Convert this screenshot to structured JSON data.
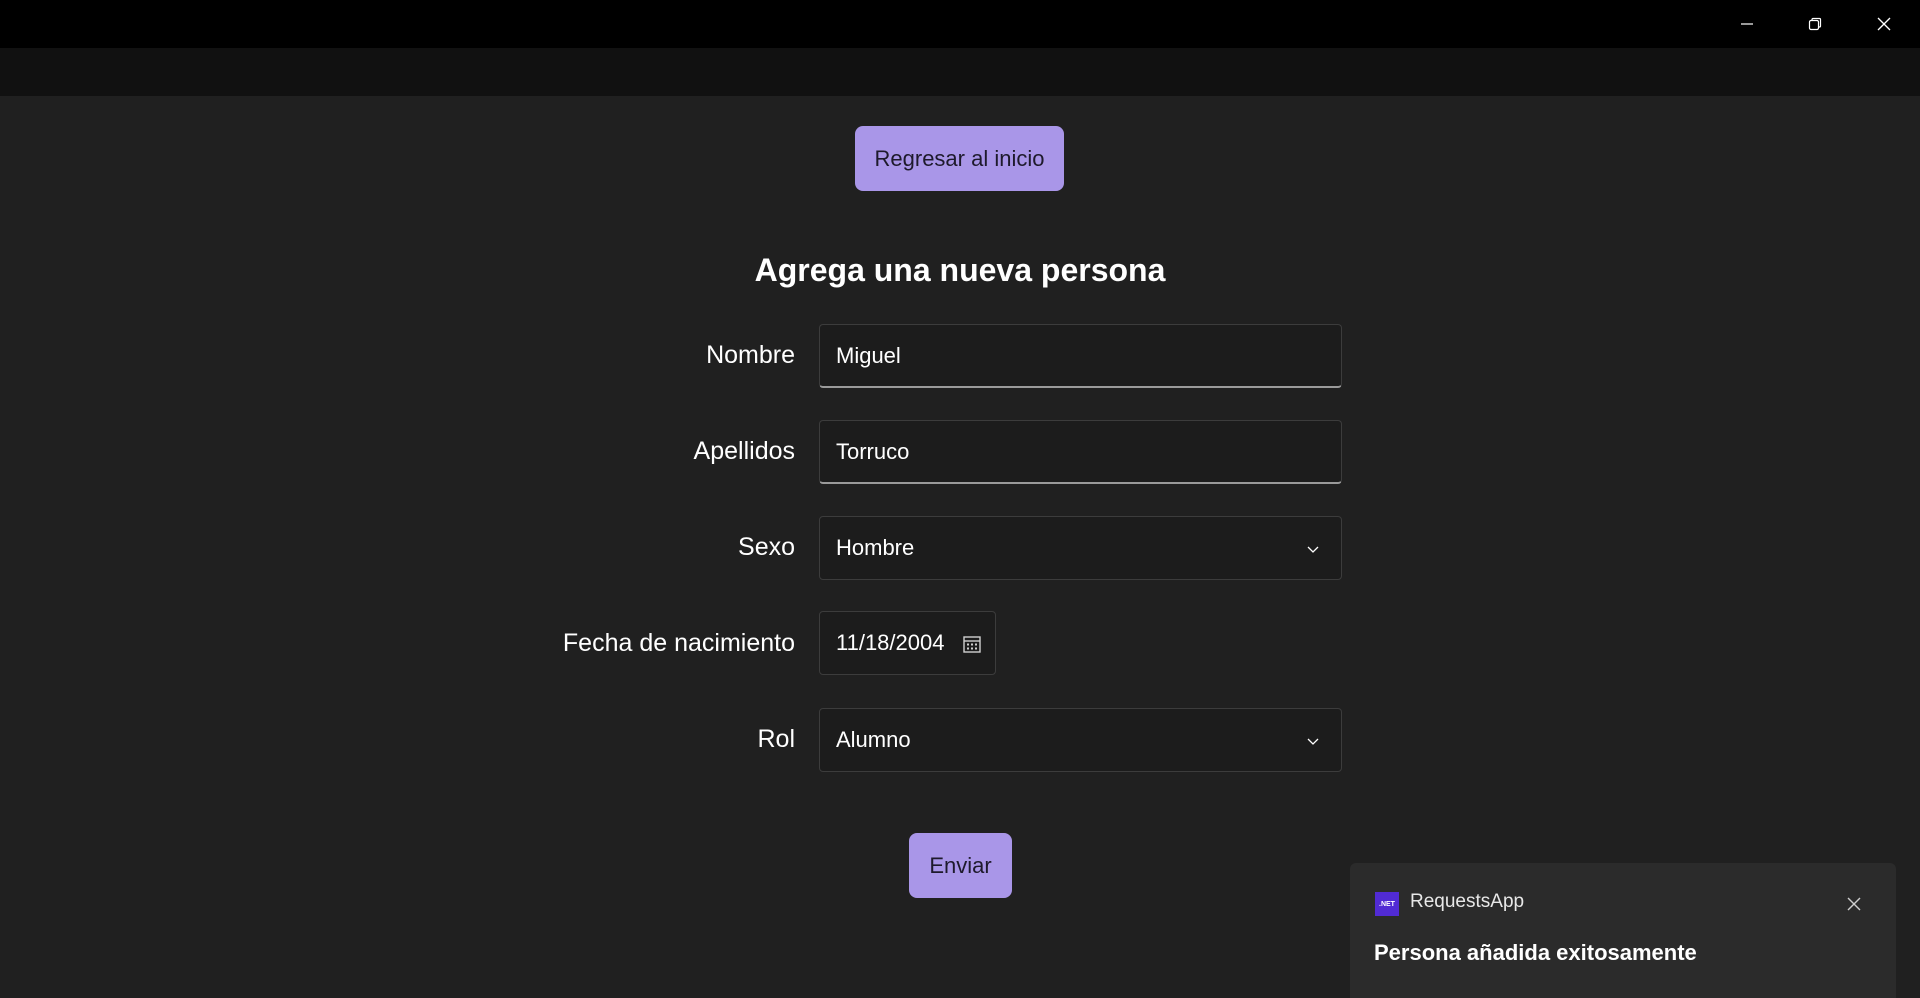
{
  "window": {
    "controls": [
      "minimize-icon",
      "restore-icon",
      "close-icon"
    ]
  },
  "nav": {
    "back_home_label": "Regresar al inicio"
  },
  "form": {
    "title": "Agrega una nueva persona",
    "fields": {
      "nombre": {
        "label": "Nombre",
        "value": "Miguel"
      },
      "apellidos": {
        "label": "Apellidos",
        "value": "Torruco"
      },
      "sexo": {
        "label": "Sexo",
        "selected": "Hombre"
      },
      "fecha": {
        "label": "Fecha de nacimiento",
        "value": "11/18/2004"
      },
      "rol": {
        "label": "Rol",
        "selected": "Alumno"
      }
    },
    "submit_label": "Enviar"
  },
  "toast": {
    "app_badge": ".NET",
    "app_name": "RequestsApp",
    "message": "Persona añadida exitosamente"
  },
  "colors": {
    "accent": "#a996e8",
    "background": "#202020",
    "titlebar": "#000000",
    "navbar": "#111111",
    "toast": "#2b2b2b",
    "dotnet_badge": "#512bd4"
  }
}
